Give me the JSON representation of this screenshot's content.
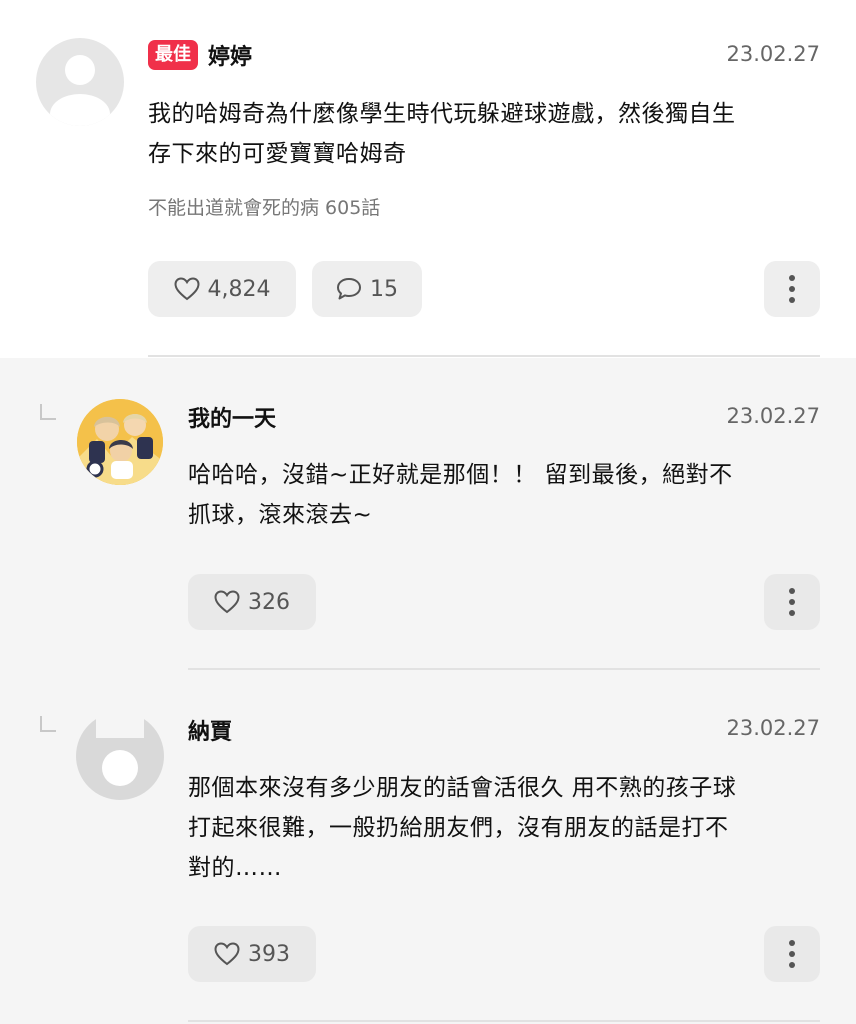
{
  "best_comment": {
    "badge": "最佳",
    "username": "婷婷",
    "date": "23.02.27",
    "text_line1": "我的哈姆奇為什麼像學生時代玩躲避球遊戲，然後獨自生",
    "text_line2": "存下來的可愛寶寶哈姆奇",
    "episode": "不能出道就會死的病 605話",
    "likes": "4,824",
    "replies": "15"
  },
  "replies": [
    {
      "username": "我的一天",
      "date": "23.02.27",
      "text_line1": "哈哈哈，沒錯~正好就是那個！！ 留到最後，絕對不",
      "text_line2": "抓球，滾來滾去~",
      "text_line3": "",
      "likes": "326"
    },
    {
      "username": "納賈",
      "date": "23.02.27",
      "text_line1": "那個本來沒有多少朋友的話會活很久 用不熟的孩子球",
      "text_line2": "打起來很難，一般扔給朋友們，沒有朋友的話是打不",
      "text_line3": "對的……",
      "likes": "393"
    }
  ],
  "icons": {
    "like": "heart-outline-icon",
    "comment": "speech-bubble-icon",
    "more": "vertical-ellipsis-icon",
    "reply": "reply-arrow-icon"
  },
  "colors": {
    "best_badge": "#f0304a",
    "reply_background": "#f5f5f5",
    "button_background": "#eeeeee"
  }
}
